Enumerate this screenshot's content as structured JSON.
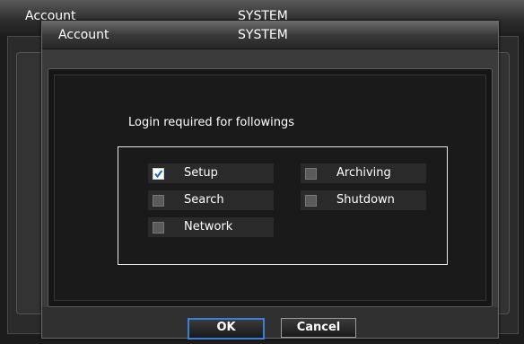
{
  "background_window": {
    "title_left": "Account",
    "title_center": "SYSTEM"
  },
  "dialog": {
    "title_left": "Account",
    "title_center": "SYSTEM",
    "login_label": "Login required for followings",
    "options": [
      {
        "label": "Setup",
        "checked": true
      },
      {
        "label": "Search",
        "checked": false
      },
      {
        "label": "Network",
        "checked": false
      },
      {
        "label": "Archiving",
        "checked": false
      },
      {
        "label": "Shutdown",
        "checked": false
      }
    ],
    "ok_label": "OK",
    "cancel_label": "Cancel"
  },
  "colors": {
    "checkmark": "#1a5fd0",
    "ok_focus_border": "#3a7fd8"
  },
  "icons": {
    "checkmark": "checkmark-icon"
  }
}
